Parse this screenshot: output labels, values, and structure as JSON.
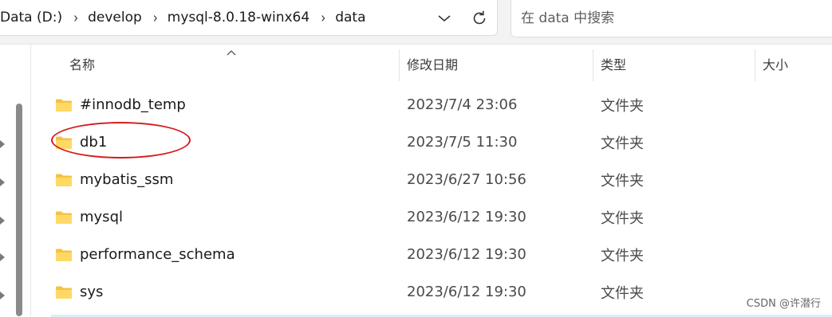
{
  "address": {
    "breadcrumbs": [
      "Data (D:)",
      "develop",
      "mysql-8.0.18-winx64",
      "data"
    ],
    "separator": "›"
  },
  "search": {
    "placeholder": "在 data 中搜索"
  },
  "columns": {
    "name": "名称",
    "modified": "修改日期",
    "type": "类型",
    "size": "大小"
  },
  "files": [
    {
      "name": "#innodb_temp",
      "modified": "2023/7/4 23:06",
      "type": "文件夹",
      "icon": "folder-icon"
    },
    {
      "name": "db1",
      "modified": "2023/7/5 11:30",
      "type": "文件夹",
      "icon": "folder-icon"
    },
    {
      "name": "mybatis_ssm",
      "modified": "2023/6/27 10:56",
      "type": "文件夹",
      "icon": "folder-icon"
    },
    {
      "name": "mysql",
      "modified": "2023/6/12 19:30",
      "type": "文件夹",
      "icon": "folder-icon"
    },
    {
      "name": "performance_schema",
      "modified": "2023/6/12 19:30",
      "type": "文件夹",
      "icon": "folder-icon"
    },
    {
      "name": "sys",
      "modified": "2023/6/12 19:30",
      "type": "文件夹",
      "icon": "folder-icon"
    }
  ],
  "watermark": "CSDN @许潜行",
  "colors": {
    "folder": "#f5c242",
    "annotation": "#d51b1b",
    "selection": "#dbeefa"
  }
}
